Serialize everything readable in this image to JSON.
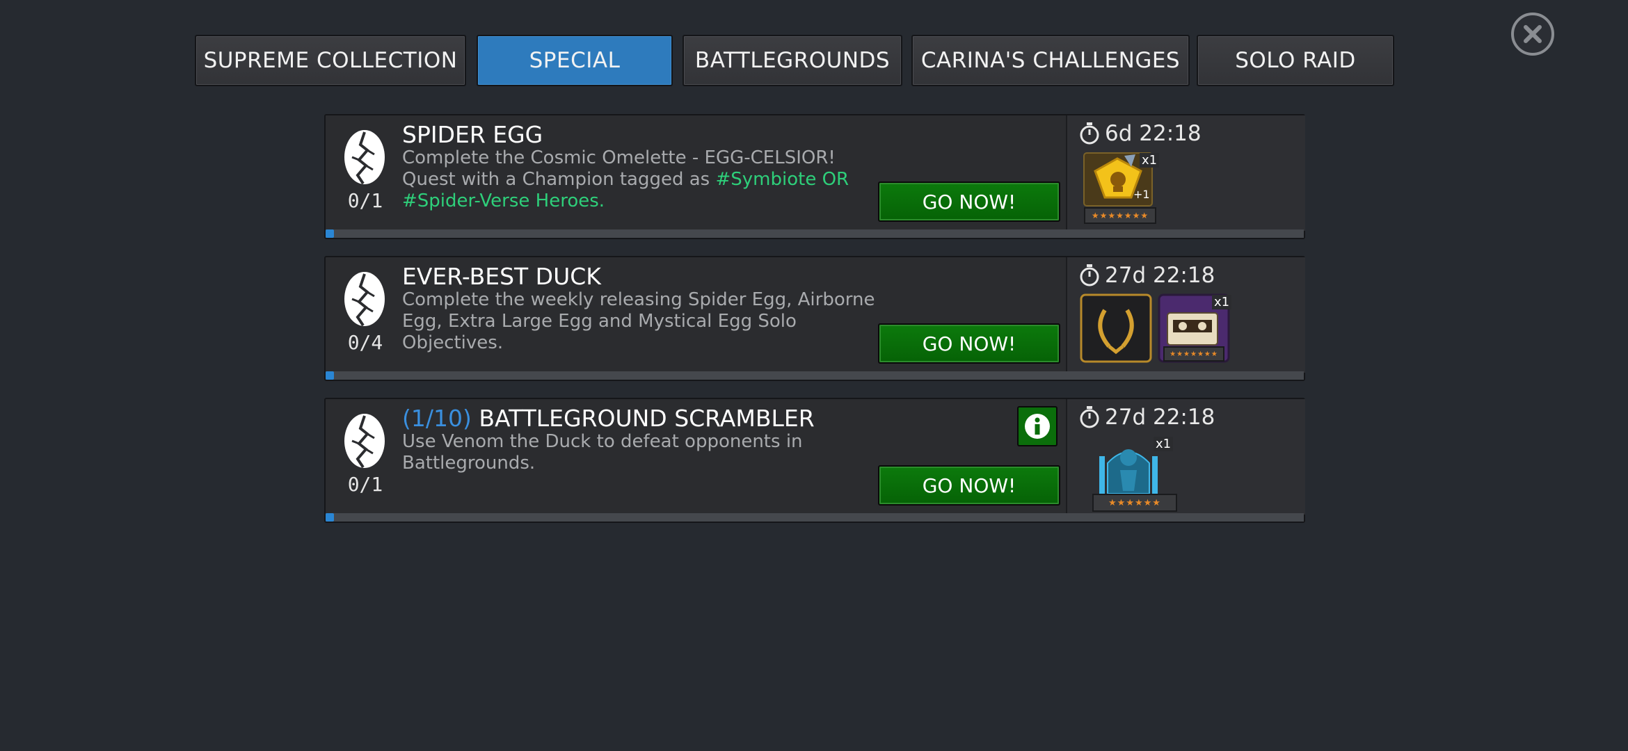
{
  "tabs": [
    {
      "label": "SUPREME COLLECTION",
      "active": false
    },
    {
      "label": "SPECIAL",
      "active": true
    },
    {
      "label": "BATTLEGROUNDS",
      "active": false
    },
    {
      "label": "CARINA'S CHALLENGES",
      "active": false
    },
    {
      "label": "SOLO RAID",
      "active": false
    }
  ],
  "objectives": [
    {
      "title": "SPIDER EGG",
      "count": "",
      "desc_plain": "Complete the Cosmic Omelette - EGG-CELSIOR! Quest with a Champion tagged as ",
      "desc_tags": "#Symbiote OR #Spider-Verse Heroes.",
      "progress": "0/1",
      "progress_fraction": 0.0,
      "button": "GO NOW!",
      "timer": "6d 22:18",
      "rewards": [
        {
          "icon": "gold-crystal-icon",
          "qty": "x1",
          "bonus": "+1",
          "stars": "★★★★★★★"
        }
      ]
    },
    {
      "title": "EVER-BEST DUCK",
      "count": "",
      "desc_plain": "Complete the weekly releasing Spider Egg, Airborne Egg, Extra Large Egg and Mystical Egg Solo Objectives.",
      "desc_tags": "",
      "progress": "0/4",
      "progress_fraction": 0.0,
      "button": "GO NOW!",
      "timer": "27d 22:18",
      "rewards": [
        {
          "icon": "laurel-title-icon",
          "qty": "",
          "stars": ""
        },
        {
          "icon": "cassette-tape-icon",
          "qty": "x1",
          "stars": "★★★★★★★"
        }
      ]
    },
    {
      "title": "BATTLEGROUND SCRAMBLER",
      "count": "(1/10)",
      "desc_plain": "Use Venom the Duck to defeat opponents in Battlegrounds.",
      "desc_tags": "",
      "progress": "0/1",
      "progress_fraction": 0.0,
      "button": "GO NOW!",
      "timer": "27d 22:18",
      "rewards": [
        {
          "icon": "statue-trophy-icon",
          "qty": "x1",
          "stars": "★★★★★★"
        }
      ]
    }
  ],
  "colors": {
    "accent": "#2e7bbd",
    "go_button": "#0c7a0c",
    "tag": "#2ecf7a",
    "count": "#3a8fde",
    "progress": "#2a86d4"
  }
}
